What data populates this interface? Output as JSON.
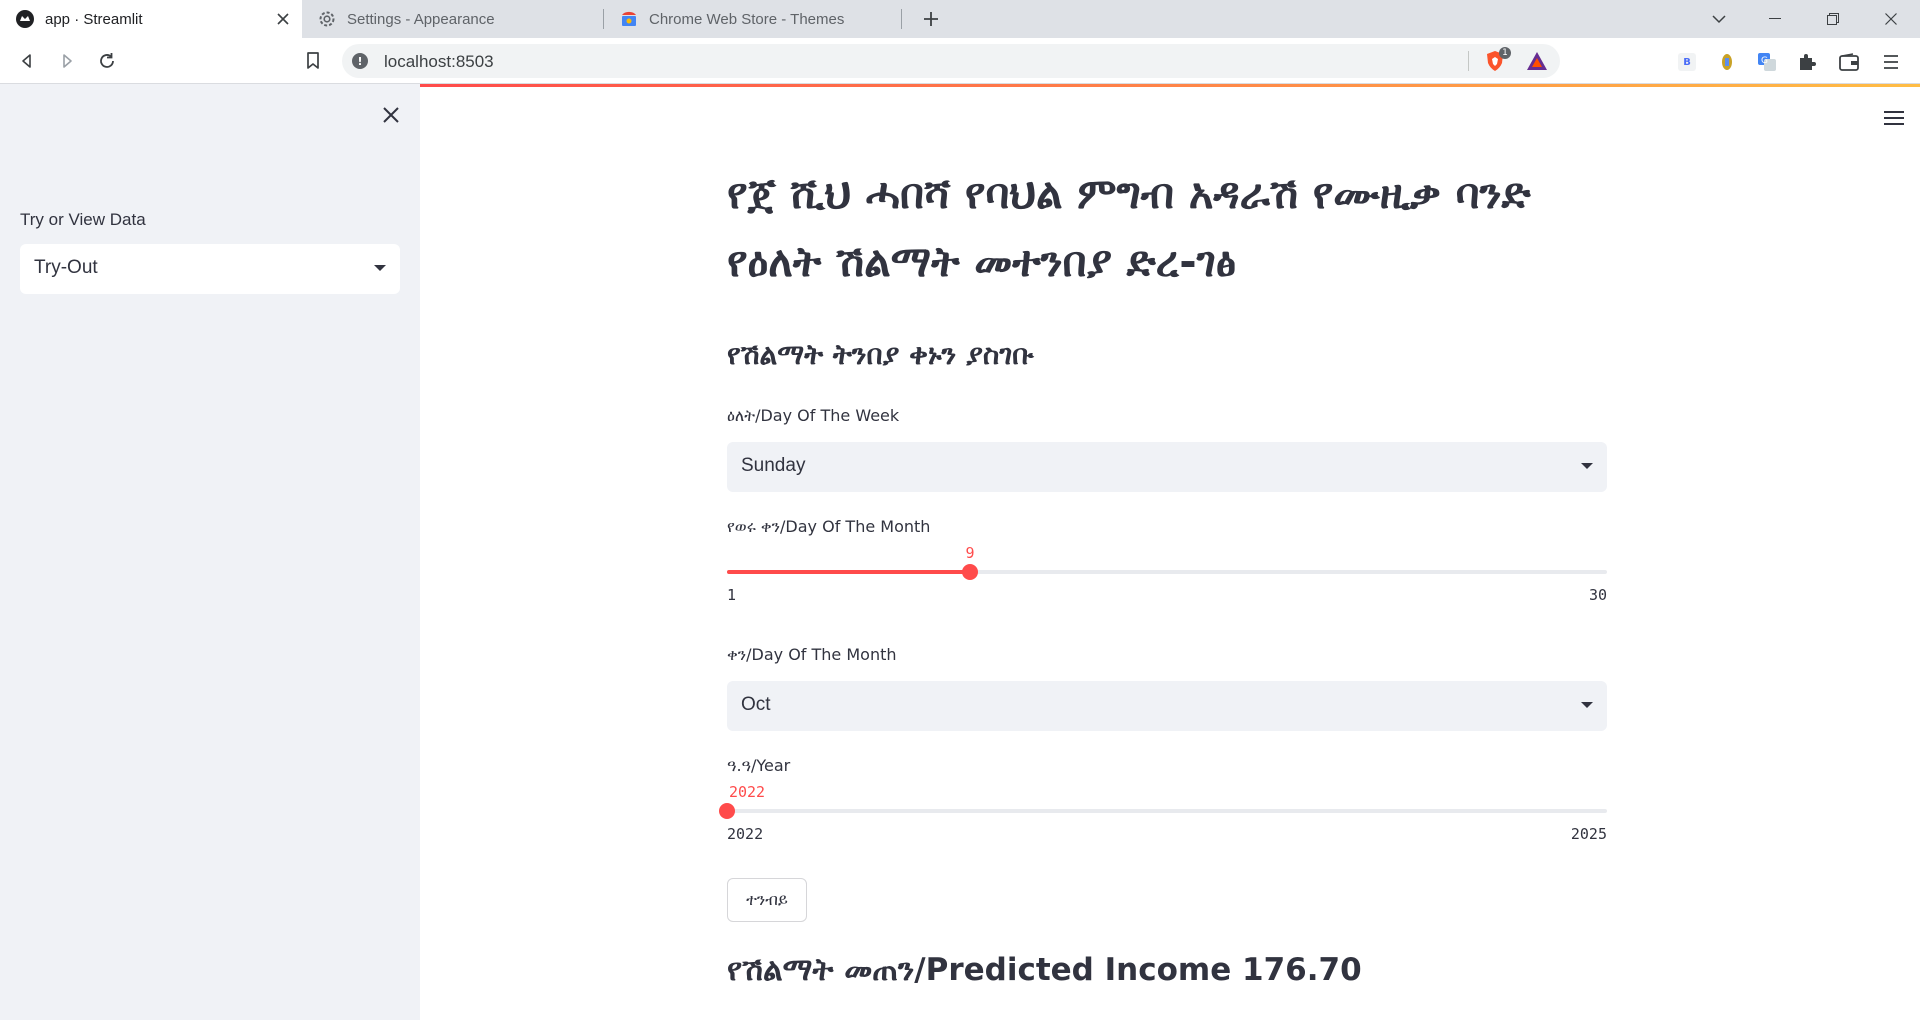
{
  "browser": {
    "tabs": [
      {
        "title": "app · Streamlit",
        "active": true
      },
      {
        "title": "Settings - Appearance",
        "active": false
      },
      {
        "title": "Chrome Web Store - Themes",
        "active": false
      }
    ],
    "address": "localhost:8503",
    "shield_count": "1",
    "extension_badge": "B",
    "icons": [
      "back-icon",
      "forward-icon",
      "reload-icon",
      "bookmark-icon",
      "info-icon",
      "brave-shield-icon",
      "brave-rewards-icon",
      "extension-icon",
      "puzzle-icon",
      "wallet-icon",
      "menu-icon"
    ]
  },
  "sidebar": {
    "label": "Try or View Data",
    "selected": "Try-Out"
  },
  "main": {
    "title": "የጀ ሺህ ሓበሻ የባህል ምግብ አዳራሽ የሙዚቃ ባንድ የዕለት ሽልማት መተንበያ ድረ-ገፅ",
    "subheader": "የሽልማት ትንበያ ቀኑን ያስገቡ",
    "day_of_week": {
      "label": "ዕለት/Day Of The Week",
      "value": "Sunday"
    },
    "day_of_month": {
      "label": "የወሩ ቀን/Day Of The Month",
      "value": 9,
      "min": 1,
      "max": 30
    },
    "month": {
      "label": "ቀን/Day Of The Month",
      "value": "Oct"
    },
    "year": {
      "label": "ዓ.ዓ/Year",
      "value": 2022,
      "min": 2022,
      "max": 2025
    },
    "predict_button": "ተንብይ",
    "result": "የሽልማት መጠን/Predicted Income 176.70"
  },
  "colors": {
    "accent": "#ff4b4b",
    "sidebar_bg": "#f0f2f6",
    "text": "#31333f"
  }
}
